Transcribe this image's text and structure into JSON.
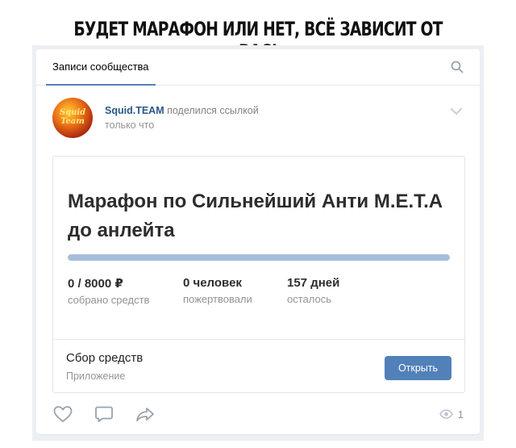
{
  "headline": "БУДЕТ МАРАФОН ИЛИ НЕТ, ВСЁ ЗАВИСИТ ОТ ВАС!",
  "tabs": {
    "active_label": "Записи сообщества"
  },
  "post": {
    "avatar_text": "Squid Team",
    "author": "Squid.TEAM",
    "action": " поделился ссылкой",
    "time": "только что"
  },
  "fundraiser": {
    "title": "Марафон по Сильнейший Анти М.Е.Т.А до анлейта",
    "progress_fraction": 1.0,
    "stats": [
      {
        "value": "0 / 8000 ₽",
        "label": "собрано средств"
      },
      {
        "value": "0 человек",
        "label": "пожертвовали"
      },
      {
        "value": "157 дней",
        "label": "осталось"
      }
    ],
    "app_title": "Сбор средств",
    "app_subtitle": "Приложение",
    "open_label": "Открыть"
  },
  "footer": {
    "views_count": "1"
  },
  "icons": {
    "search": "search-icon",
    "chevron": "chevron-down-icon",
    "like": "heart-icon",
    "comment": "comment-icon",
    "share": "share-icon",
    "views": "eye-icon"
  },
  "colors": {
    "accent": "#5181b8",
    "author": "#2a5885",
    "progress_fill": "#a6bedc"
  }
}
